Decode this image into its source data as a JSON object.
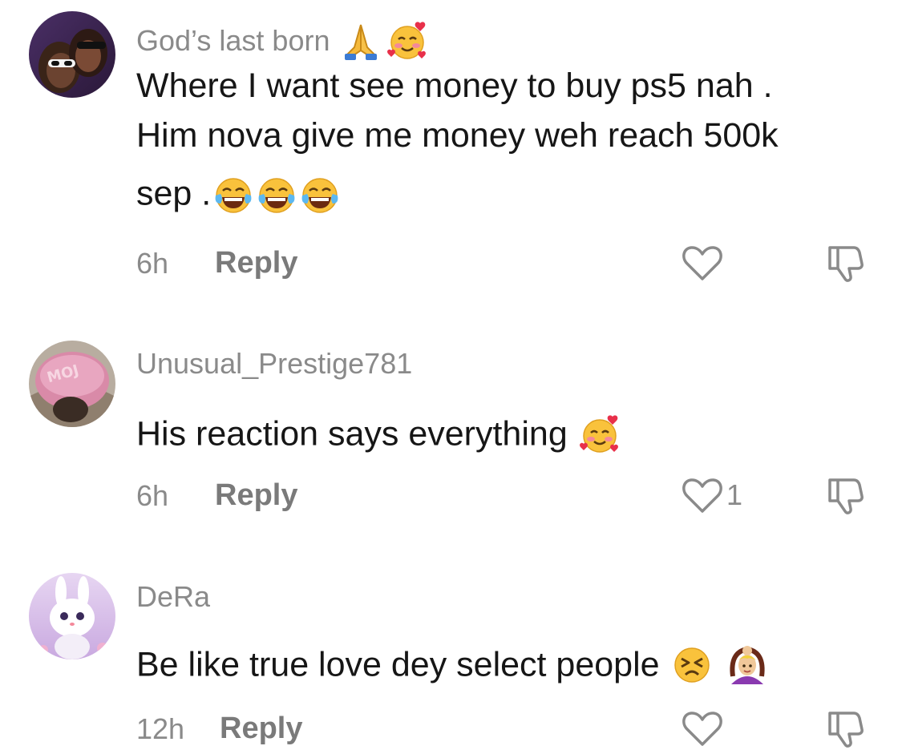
{
  "comments": [
    {
      "username": "God’s last born",
      "username_emojis": [
        "folded-hands-emoji",
        "smiling-face-with-hearts-emoji"
      ],
      "text_lines": [
        "Where I want see money to buy ps5 nah .",
        "Him nova give me money weh reach 500k",
        "sep ."
      ],
      "text_emojis": [
        "tears-of-joy-emoji",
        "tears-of-joy-emoji",
        "tears-of-joy-emoji"
      ],
      "time": "6h",
      "reply_label": "Reply",
      "like_count": "",
      "avatar": "two-people-sunglasses-avatar"
    },
    {
      "username": "Unusual_Prestige781",
      "text_lines": [
        "His reaction says everything"
      ],
      "text_emojis": [
        "smiling-face-with-hearts-emoji"
      ],
      "time": "6h",
      "reply_label": "Reply",
      "like_count": "1",
      "avatar": "pink-beanie-avatar"
    },
    {
      "username": "DeRa",
      "text_lines": [
        "Be like true love dey select people"
      ],
      "text_emojis": [
        "persevering-face-emoji",
        "person-gesturing-ok-emoji"
      ],
      "time": "12h",
      "reply_label": "Reply",
      "like_count": "",
      "avatar": "white-bunny-avatar"
    }
  ],
  "colors": {
    "username": "#8a8a8a",
    "body_text": "#161616",
    "meta": "#8a8a8a",
    "reply": "#7a7a7a",
    "icon_stroke": "#8a8a8a"
  },
  "icons": {
    "like": "heart-outline-icon",
    "dislike": "thumbs-down-outline-icon"
  }
}
